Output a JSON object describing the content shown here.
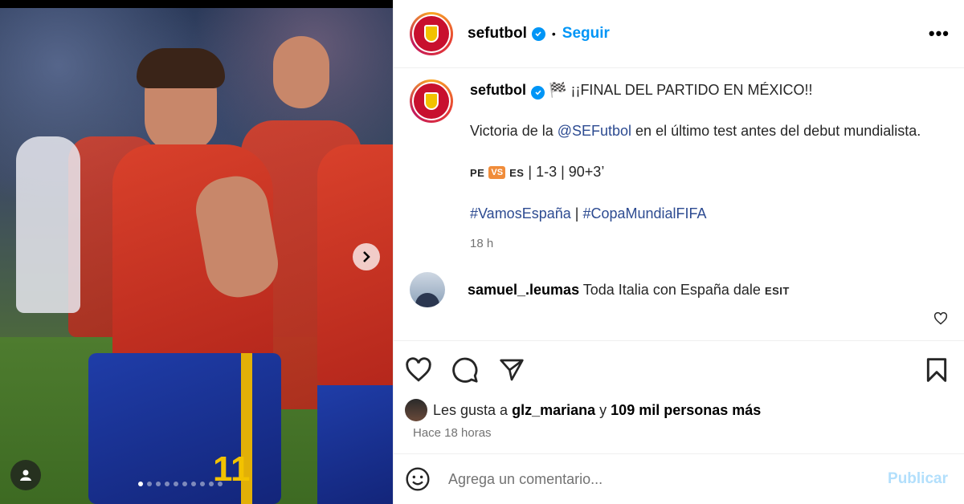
{
  "post": {
    "username": "sefutbol",
    "follow_label": "Seguir",
    "separator": "•",
    "more_label": "•••"
  },
  "caption": {
    "username": "sefutbol",
    "flag_emoji": "🏁",
    "headline": "¡¡FINAL DEL PARTIDO EN MÉXICO!!",
    "line2_prefix": "Victoria de la ",
    "mention": "@SEFutbol",
    "line2_suffix": " en el último test antes del debut mundialista.",
    "score_team1": "PE",
    "score_vs": "VS",
    "score_team2": "ES",
    "score_text": " | 1-3 | 90+3’",
    "hashtag1": "#VamosEspaña",
    "hashtag_sep": " | ",
    "hashtag2": "#CopaMundialFIFA",
    "time": "18 h"
  },
  "comment": {
    "username": "samuel_.leumas",
    "text": "Toda Italia con España dale",
    "flags": "ESIT"
  },
  "likes": {
    "prefix": "Les gusta a ",
    "user": "glz_mariana",
    "middle": " y ",
    "count": "109 mil personas más",
    "time_ago": "Hace 18 horas"
  },
  "composer": {
    "placeholder": "Agrega un comentario...",
    "post_label": "Publicar"
  },
  "carousel": {
    "slide_count": 10,
    "active_index": 0
  },
  "media": {
    "jersey_number": "11"
  }
}
